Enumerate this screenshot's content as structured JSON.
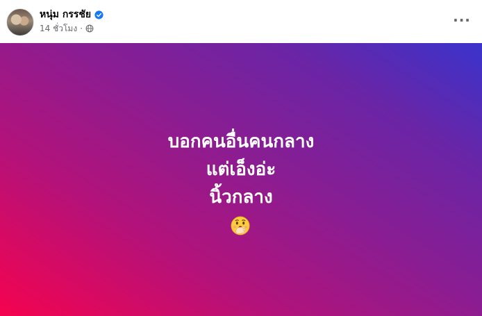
{
  "author": {
    "name": "หนุ่ม กรรชัย",
    "verified": true,
    "avatar_icon": "profile-photo"
  },
  "meta": {
    "time": "14 ชั่วโมง",
    "separator": "·",
    "privacy_icon": "globe-icon"
  },
  "menu": {
    "more_label": "···"
  },
  "post": {
    "lines": [
      "บอกคนอื่นคนกลาง",
      "แต่เอ็งอ่ะ",
      "นิ้วกลาง"
    ],
    "emoji": "🫢",
    "emoji_name": "face-with-hand-over-mouth",
    "background_colors": [
      "#f5034f",
      "#8a1d92",
      "#3a33cc"
    ]
  },
  "colors": {
    "verified_blue": "#1877f2",
    "secondary_text": "#65676b"
  }
}
